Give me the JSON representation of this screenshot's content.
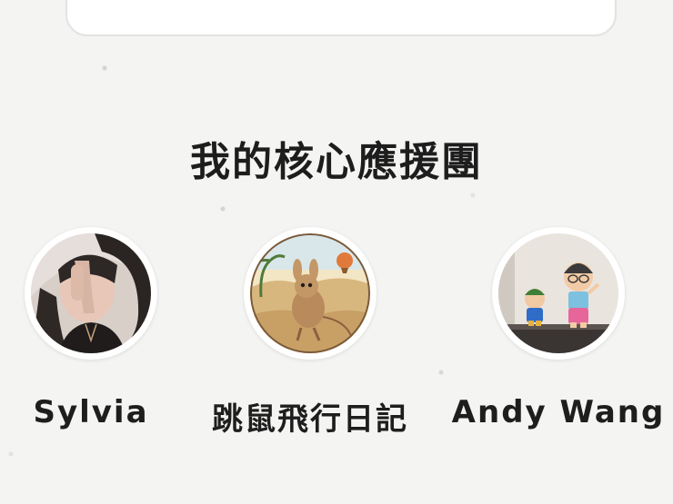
{
  "section": {
    "title": "我的核心應援團"
  },
  "supporters": [
    {
      "name": "Sylvia",
      "avatar_icon": "person-photo-avatar"
    },
    {
      "name": "跳鼠飛行日記",
      "avatar_icon": "jerboa-illustration-avatar"
    },
    {
      "name": "Andy Wang",
      "avatar_icon": "toy-figures-photo-avatar"
    }
  ],
  "colors": {
    "background": "#f4f4f2",
    "card": "#ffffff",
    "text": "#1e1e1e"
  }
}
